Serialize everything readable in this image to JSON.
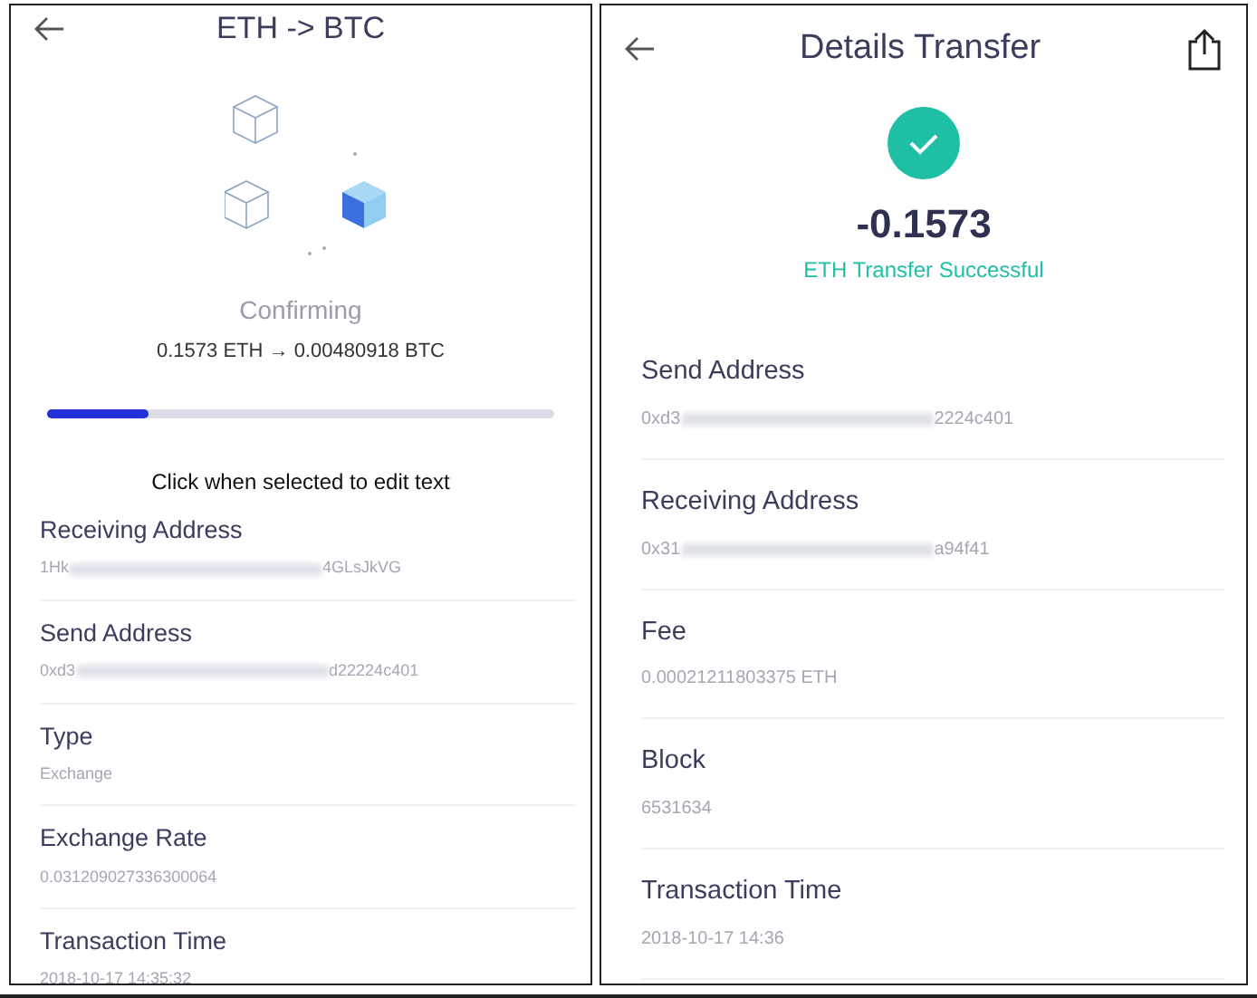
{
  "screens": [
    {
      "title": "ETH -> BTC",
      "share": false,
      "status": "Confirming",
      "amount_line": "0.1573 ETH → 0.00480918 BTC",
      "progress": {
        "level": 0.2
      },
      "hint": "Click when selected to edit text",
      "fields": [
        {
          "label": "Receiving Address",
          "kind": "redacted",
          "start": "1Hk",
          "end": "4GLsJkVG"
        },
        {
          "label": "Send Address",
          "kind": "redacted",
          "start": "0xd3",
          "end": "d22224c401"
        },
        {
          "label": "Type",
          "kind": "plain",
          "value": "Exchange"
        },
        {
          "label": "Exchange Rate",
          "kind": "plain",
          "value": "0.031209027336300064"
        },
        {
          "label": "Transaction Time",
          "kind": "plain",
          "value": "2018-10-17 14:35:32"
        }
      ]
    },
    {
      "title": "Details Transfer",
      "share": true,
      "success": {
        "amount": "-0.1573",
        "message": "ETH Transfer Successful"
      },
      "fields": [
        {
          "label": "Send Address",
          "kind": "redacted",
          "start": "0xd3",
          "end": "2224c401"
        },
        {
          "label": "Receiving Address",
          "kind": "redacted",
          "start": "0x31",
          "end": "a94f41"
        },
        {
          "label": "Fee",
          "kind": "plain",
          "value": "0.00021211803375 ETH"
        },
        {
          "label": "Block",
          "kind": "plain",
          "value": "6531634"
        },
        {
          "label": "Transaction Time",
          "kind": "plain",
          "value": "2018-10-17 14:36"
        }
      ]
    }
  ]
}
